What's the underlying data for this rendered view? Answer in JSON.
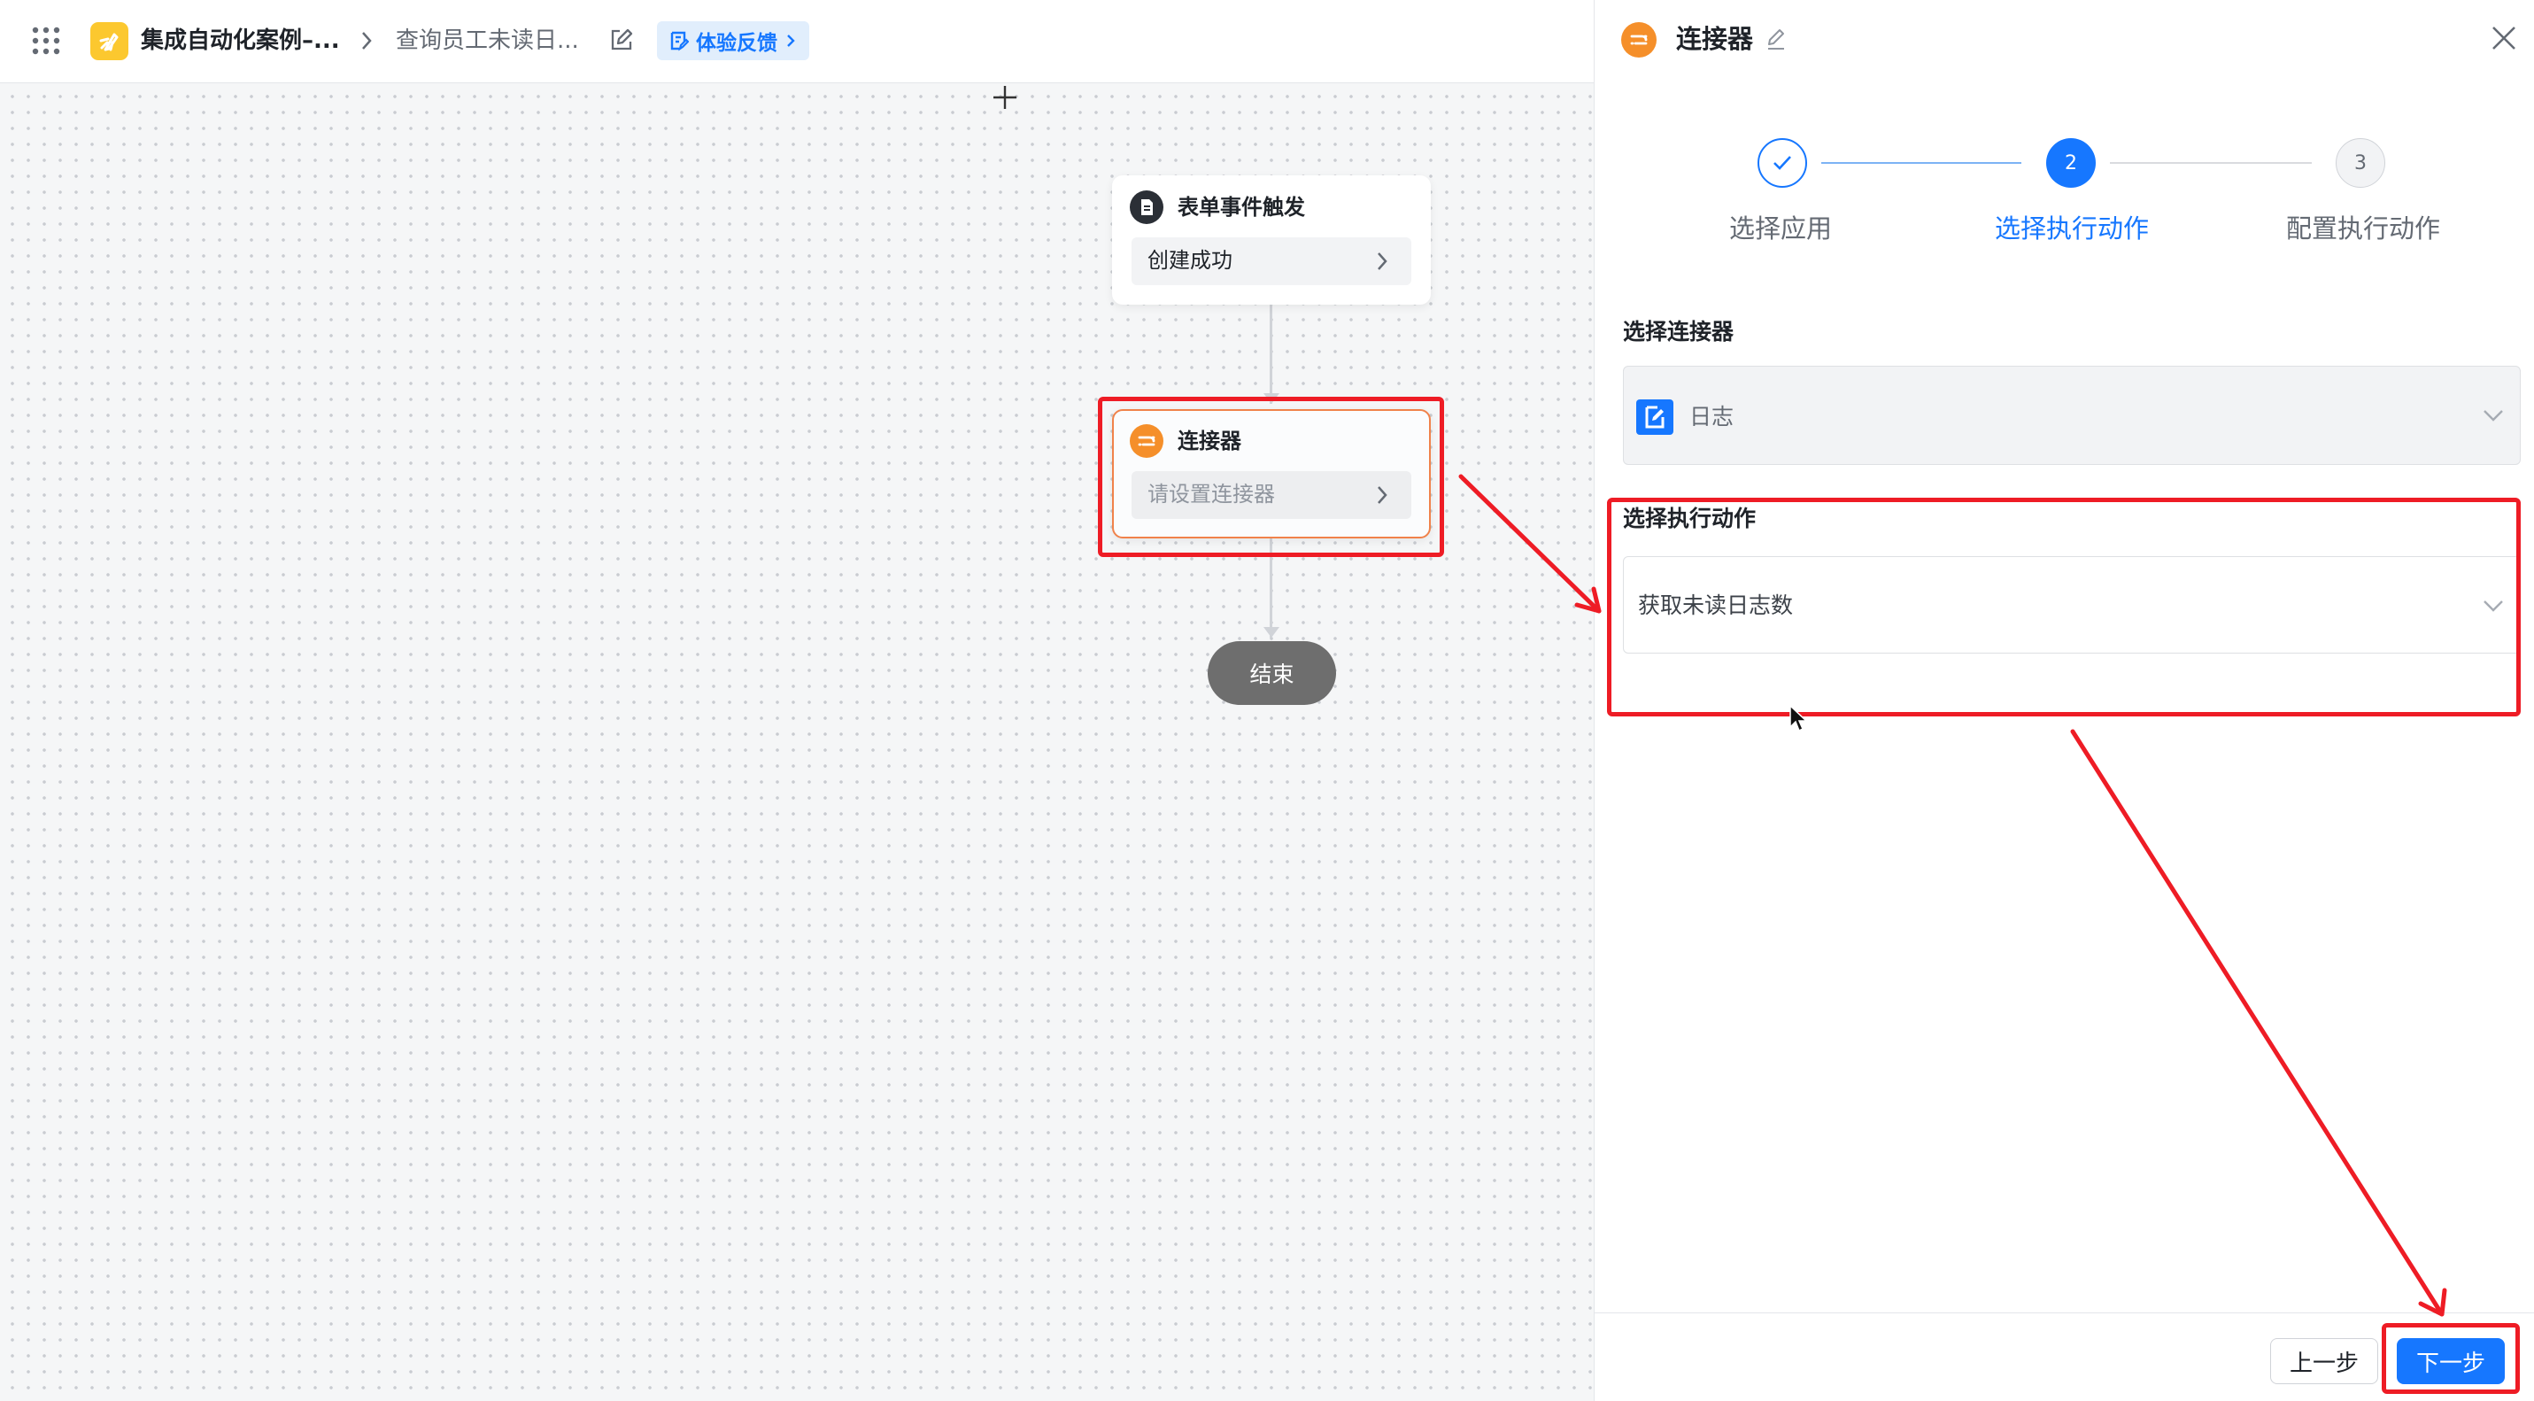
{
  "topbar": {
    "app_name": "集成自动化案例–...",
    "flow_name": "查询员工未读日...",
    "feedback_label": "体验反馈"
  },
  "canvas": {
    "trigger": {
      "title": "表单事件触发",
      "event": "创建成功"
    },
    "connector": {
      "title": "连接器",
      "placeholder": "请设置连接器"
    },
    "end_label": "结束"
  },
  "panel": {
    "title": "连接器",
    "steps": [
      {
        "number": "1",
        "label": "选择应用",
        "status": "done"
      },
      {
        "number": "2",
        "label": "选择执行动作",
        "status": "active"
      },
      {
        "number": "3",
        "label": "配置执行动作",
        "status": "pending"
      }
    ],
    "connector_section": {
      "label": "选择连接器",
      "value": "日志"
    },
    "action_section": {
      "label": "选择执行动作",
      "value": "获取未读日志数"
    },
    "footer": {
      "prev_label": "上一步",
      "next_label": "下一步"
    }
  },
  "colors": {
    "accent": "#1677ff",
    "orange": "#f58f2a",
    "annotation_red": "#ee1c25",
    "app_icon_yellow": "#fcc82f"
  }
}
